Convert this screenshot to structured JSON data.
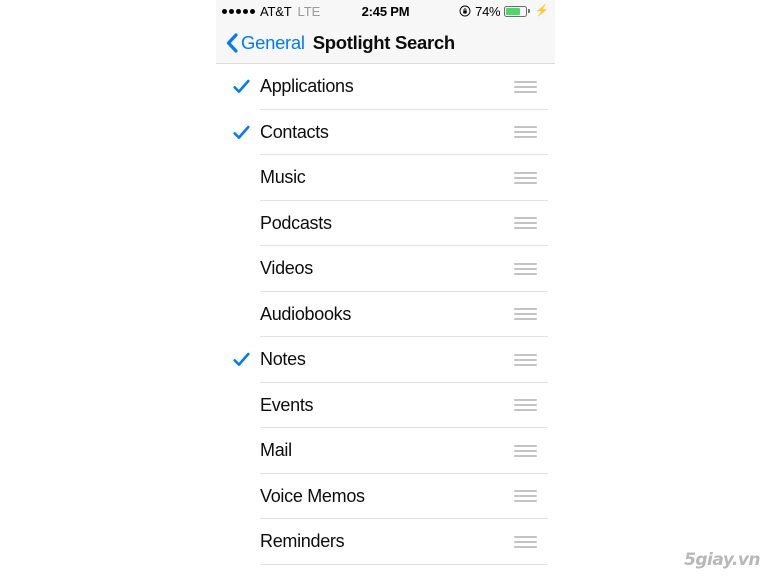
{
  "status_bar": {
    "signal_dots_filled": 5,
    "signal_dots_total": 5,
    "carrier": "AT&T",
    "network_type": "LTE",
    "time": "2:45 PM",
    "rotation_lock_icon": "rotation-lock-icon",
    "battery_percent_label": "74%",
    "battery_level": 74,
    "battery_color": "#4cd964",
    "charging_bolt": "⚡"
  },
  "nav_bar": {
    "back_chevron_icon": "chevron-left-icon",
    "back_label": "General",
    "title": "Spotlight Search",
    "accent_color": "#007aff"
  },
  "list": {
    "check_color": "#007aff",
    "rows": [
      {
        "label": "Applications",
        "checked": true
      },
      {
        "label": "Contacts",
        "checked": true
      },
      {
        "label": "Music",
        "checked": false
      },
      {
        "label": "Podcasts",
        "checked": false
      },
      {
        "label": "Videos",
        "checked": false
      },
      {
        "label": "Audiobooks",
        "checked": false
      },
      {
        "label": "Notes",
        "checked": true
      },
      {
        "label": "Events",
        "checked": false
      },
      {
        "label": "Mail",
        "checked": false
      },
      {
        "label": "Voice Memos",
        "checked": false
      },
      {
        "label": "Reminders",
        "checked": false
      }
    ]
  },
  "watermark": {
    "text": "5giay.vn"
  }
}
